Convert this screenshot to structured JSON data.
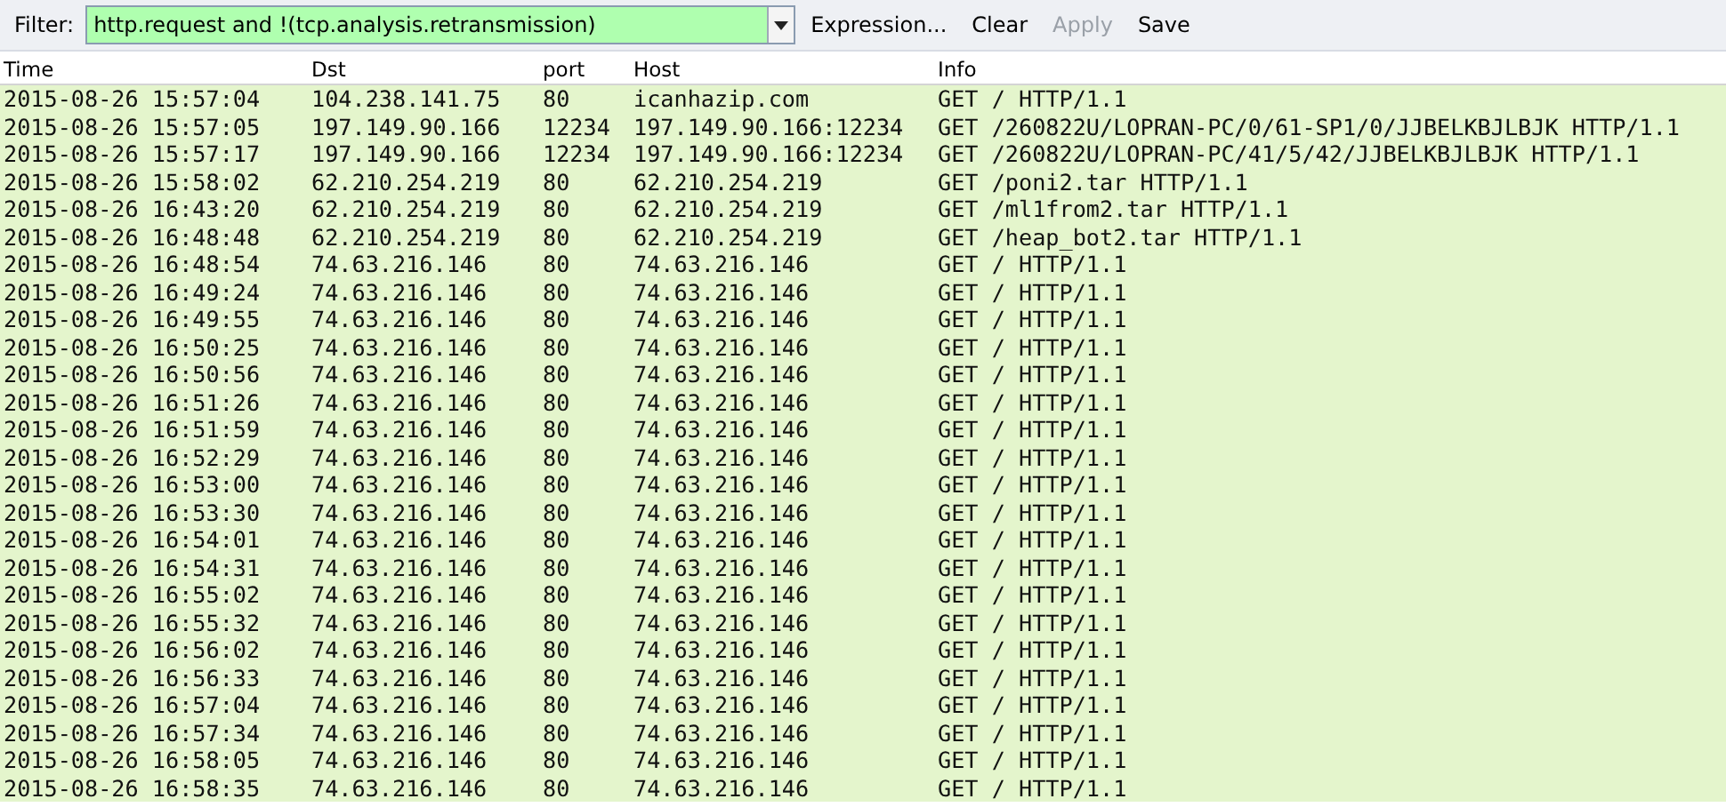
{
  "filter_bar": {
    "label": "Filter:",
    "value": "http.request and !(tcp.analysis.retransmission)",
    "buttons": [
      {
        "label": "Expression...",
        "disabled": false
      },
      {
        "label": "Clear",
        "disabled": false
      },
      {
        "label": "Apply",
        "disabled": true
      },
      {
        "label": "Save",
        "disabled": false
      }
    ]
  },
  "table": {
    "columns": [
      "Time",
      "Dst",
      "port",
      "Host",
      "Info"
    ],
    "rows": [
      [
        "2015-08-26 15:57:04",
        "104.238.141.75",
        "80",
        "icanhazip.com",
        "GET / HTTP/1.1"
      ],
      [
        "2015-08-26 15:57:05",
        "197.149.90.166",
        "12234",
        "197.149.90.166:12234",
        "GET /260822U/LOPRAN-PC/0/61-SP1/0/JJBELKBJLBJK HTTP/1.1"
      ],
      [
        "2015-08-26 15:57:17",
        "197.149.90.166",
        "12234",
        "197.149.90.166:12234",
        "GET /260822U/LOPRAN-PC/41/5/42/JJBELKBJLBJK HTTP/1.1"
      ],
      [
        "2015-08-26 15:58:02",
        "62.210.254.219",
        "80",
        "62.210.254.219",
        "GET /poni2.tar HTTP/1.1"
      ],
      [
        "2015-08-26 16:43:20",
        "62.210.254.219",
        "80",
        "62.210.254.219",
        "GET /ml1from2.tar HTTP/1.1"
      ],
      [
        "2015-08-26 16:48:48",
        "62.210.254.219",
        "80",
        "62.210.254.219",
        "GET /heap_bot2.tar HTTP/1.1"
      ],
      [
        "2015-08-26 16:48:54",
        "74.63.216.146",
        "80",
        "74.63.216.146",
        "GET / HTTP/1.1"
      ],
      [
        "2015-08-26 16:49:24",
        "74.63.216.146",
        "80",
        "74.63.216.146",
        "GET / HTTP/1.1"
      ],
      [
        "2015-08-26 16:49:55",
        "74.63.216.146",
        "80",
        "74.63.216.146",
        "GET / HTTP/1.1"
      ],
      [
        "2015-08-26 16:50:25",
        "74.63.216.146",
        "80",
        "74.63.216.146",
        "GET / HTTP/1.1"
      ],
      [
        "2015-08-26 16:50:56",
        "74.63.216.146",
        "80",
        "74.63.216.146",
        "GET / HTTP/1.1"
      ],
      [
        "2015-08-26 16:51:26",
        "74.63.216.146",
        "80",
        "74.63.216.146",
        "GET / HTTP/1.1"
      ],
      [
        "2015-08-26 16:51:59",
        "74.63.216.146",
        "80",
        "74.63.216.146",
        "GET / HTTP/1.1"
      ],
      [
        "2015-08-26 16:52:29",
        "74.63.216.146",
        "80",
        "74.63.216.146",
        "GET / HTTP/1.1"
      ],
      [
        "2015-08-26 16:53:00",
        "74.63.216.146",
        "80",
        "74.63.216.146",
        "GET / HTTP/1.1"
      ],
      [
        "2015-08-26 16:53:30",
        "74.63.216.146",
        "80",
        "74.63.216.146",
        "GET / HTTP/1.1"
      ],
      [
        "2015-08-26 16:54:01",
        "74.63.216.146",
        "80",
        "74.63.216.146",
        "GET / HTTP/1.1"
      ],
      [
        "2015-08-26 16:54:31",
        "74.63.216.146",
        "80",
        "74.63.216.146",
        "GET / HTTP/1.1"
      ],
      [
        "2015-08-26 16:55:02",
        "74.63.216.146",
        "80",
        "74.63.216.146",
        "GET / HTTP/1.1"
      ],
      [
        "2015-08-26 16:55:32",
        "74.63.216.146",
        "80",
        "74.63.216.146",
        "GET / HTTP/1.1"
      ],
      [
        "2015-08-26 16:56:02",
        "74.63.216.146",
        "80",
        "74.63.216.146",
        "GET / HTTP/1.1"
      ],
      [
        "2015-08-26 16:56:33",
        "74.63.216.146",
        "80",
        "74.63.216.146",
        "GET / HTTP/1.1"
      ],
      [
        "2015-08-26 16:57:04",
        "74.63.216.146",
        "80",
        "74.63.216.146",
        "GET / HTTP/1.1"
      ],
      [
        "2015-08-26 16:57:34",
        "74.63.216.146",
        "80",
        "74.63.216.146",
        "GET / HTTP/1.1"
      ],
      [
        "2015-08-26 16:58:05",
        "74.63.216.146",
        "80",
        "74.63.216.146",
        "GET / HTTP/1.1"
      ],
      [
        "2015-08-26 16:58:35",
        "74.63.216.146",
        "80",
        "74.63.216.146",
        "GET / HTTP/1.1"
      ]
    ]
  }
}
